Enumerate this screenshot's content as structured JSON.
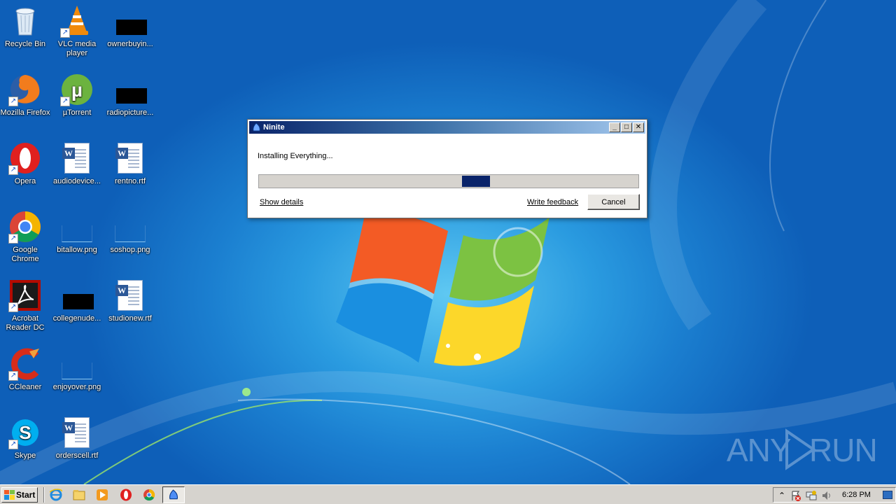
{
  "desktop": {
    "icons": [
      {
        "label": "Recycle Bin",
        "icon": "recycle-bin-icon"
      },
      {
        "label": "VLC media player",
        "icon": "vlc-icon"
      },
      {
        "label": "ownerbuyin...",
        "icon": "redacted-file-icon"
      },
      {
        "label": "Mozilla Firefox",
        "icon": "firefox-icon"
      },
      {
        "label": "µTorrent",
        "icon": "utorrent-icon"
      },
      {
        "label": "radiopicture...",
        "icon": "redacted-file-icon"
      },
      {
        "label": "Opera",
        "icon": "opera-icon"
      },
      {
        "label": "audiodevice...",
        "icon": "word-document-icon"
      },
      {
        "label": "rentno.rtf",
        "icon": "word-document-icon"
      },
      {
        "label": "Google Chrome",
        "icon": "chrome-icon"
      },
      {
        "label": "bitallow.png",
        "icon": "png-image-icon"
      },
      {
        "label": "soshop.png",
        "icon": "png-image-icon"
      },
      {
        "label": "Acrobat Reader DC",
        "icon": "acrobat-icon"
      },
      {
        "label": "collegenude...",
        "icon": "redacted-file-icon"
      },
      {
        "label": "studionew.rtf",
        "icon": "word-document-icon"
      },
      {
        "label": "CCleaner",
        "icon": "ccleaner-icon"
      },
      {
        "label": "enjoyover.png",
        "icon": "png-image-icon"
      },
      {
        "label": "Skype",
        "icon": "skype-icon"
      },
      {
        "label": "orderscell.rtf",
        "icon": "word-document-icon"
      }
    ]
  },
  "ninite": {
    "title": "Ninite",
    "status": "Installing Everything...",
    "progress_indeterminate": true,
    "show_details_label": "Show details",
    "write_feedback_label": "Write feedback",
    "cancel_label": "Cancel",
    "accent_color": "#0a246a"
  },
  "watermark": {
    "left": "ANY",
    "right": "RUN"
  },
  "taskbar": {
    "start_label": "Start",
    "quick_launch": [
      "ie-icon",
      "explorer-icon",
      "media-player-icon",
      "opera-icon",
      "chrome-icon"
    ],
    "running": [
      "ninite-icon"
    ],
    "tray_icons": [
      "show-hidden-icons-icon",
      "action-center-flag-icon",
      "network-icon",
      "volume-icon"
    ],
    "clock": "6:28 PM"
  }
}
